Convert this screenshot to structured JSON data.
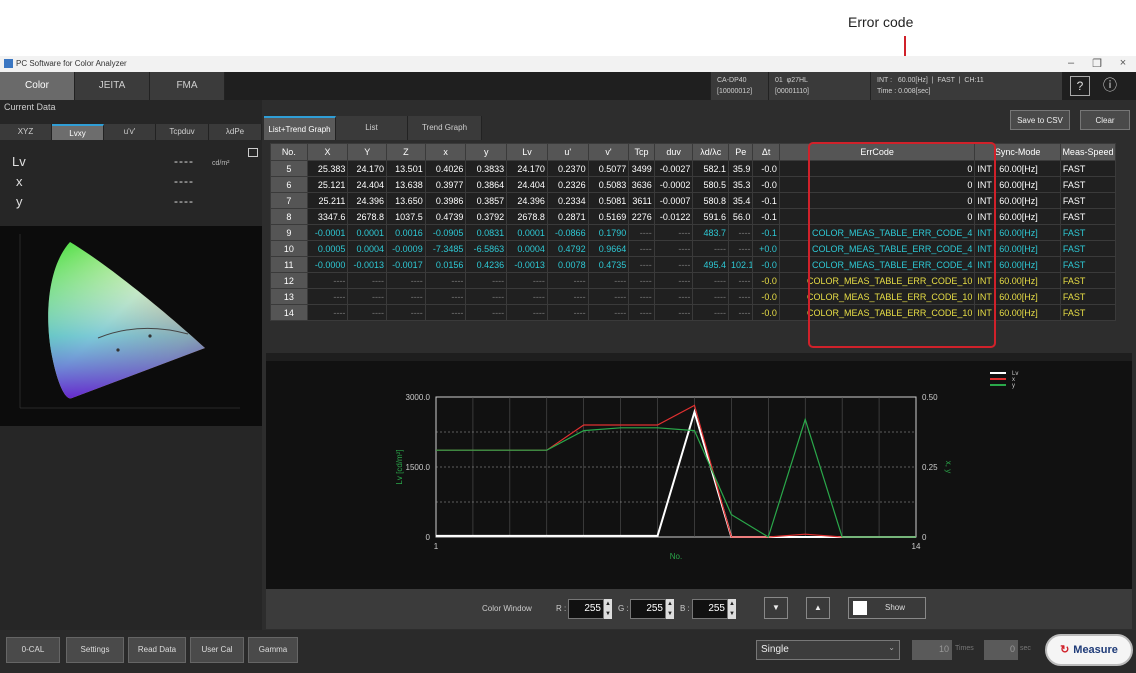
{
  "annotation": {
    "label": "Error code"
  },
  "titlebar": {
    "title": "PC Software for Color Analyzer",
    "min": "–",
    "max": "❐",
    "close": "×"
  },
  "top_tabs": [
    "Color",
    "JEITA",
    "FMA"
  ],
  "status": {
    "device": "CA-DP40\n[10000012]",
    "probe": "01  φ27HL\n[00001110]",
    "sync": "INT :   60.00[Hz]  |  FAST  |  CH:11\nTime : 0.008[sec]",
    "help": "?",
    "info": "ⓘ"
  },
  "left": {
    "current_data": "Current Data",
    "tabs": [
      "XYZ",
      "Lvxy",
      "u'v'",
      "Tcpduv",
      "λdPe"
    ],
    "rows": [
      {
        "label": "Lv",
        "value": "----",
        "unit": "cd/m²"
      },
      {
        "label": "x",
        "value": "----"
      },
      {
        "label": "y",
        "value": "----"
      }
    ]
  },
  "graph_tabs": [
    "List+Trend Graph",
    "List",
    "Trend Graph"
  ],
  "buttons": {
    "save_csv": "Save to CSV",
    "clear": "Clear"
  },
  "table": {
    "headers": [
      "No.",
      "X",
      "Y",
      "Z",
      "x",
      "y",
      "Lv",
      "u'",
      "v'",
      "Tcp",
      "duv",
      "λd/λc",
      "Pe",
      "Δt",
      "ErrCode",
      "Sync-Mode",
      "Meas-Speed"
    ],
    "rows": [
      {
        "style": "",
        "cells": [
          "5",
          "25.383",
          "24.170",
          "13.501",
          "0.4026",
          "0.3833",
          "24.170",
          "0.2370",
          "0.5077",
          "3499",
          "-0.0027",
          "582.1",
          "35.9",
          "-0.0",
          "0",
          "INT : 60.00[Hz]",
          "FAST"
        ]
      },
      {
        "style": "",
        "cells": [
          "6",
          "25.121",
          "24.404",
          "13.638",
          "0.3977",
          "0.3864",
          "24.404",
          "0.2326",
          "0.5083",
          "3636",
          "-0.0002",
          "580.5",
          "35.3",
          "-0.0",
          "0",
          "INT : 60.00[Hz]",
          "FAST"
        ]
      },
      {
        "style": "",
        "cells": [
          "7",
          "25.211",
          "24.396",
          "13.650",
          "0.3986",
          "0.3857",
          "24.396",
          "0.2334",
          "0.5081",
          "3611",
          "-0.0007",
          "580.8",
          "35.4",
          "-0.1",
          "0",
          "INT : 60.00[Hz]",
          "FAST"
        ]
      },
      {
        "style": "",
        "cells": [
          "8",
          "3347.6",
          "2678.8",
          "1037.5",
          "0.4739",
          "0.3792",
          "2678.8",
          "0.2871",
          "0.5169",
          "2276",
          "-0.0122",
          "591.6",
          "56.0",
          "-0.1",
          "0",
          "INT : 60.00[Hz]",
          "FAST"
        ]
      },
      {
        "style": "cyan",
        "cells": [
          "9",
          "-0.0001",
          "0.0001",
          "0.0016",
          "-0.0905",
          "0.0831",
          "0.0001",
          "-0.0866",
          "0.1790",
          "----",
          "----",
          "483.7",
          "----",
          "-0.1",
          "COLOR_MEAS_TABLE_ERR_CODE_4",
          "INT : 60.00[Hz]",
          "FAST"
        ]
      },
      {
        "style": "cyan",
        "cells": [
          "10",
          "0.0005",
          "0.0004",
          "-0.0009",
          "-7.3485",
          "-6.5863",
          "0.0004",
          "0.4792",
          "0.9664",
          "----",
          "----",
          "----",
          "----",
          "+0.0",
          "COLOR_MEAS_TABLE_ERR_CODE_4",
          "INT : 60.00[Hz]",
          "FAST"
        ]
      },
      {
        "style": "cyan",
        "cells": [
          "11",
          "-0.0000",
          "-0.0013",
          "-0.0017",
          "0.0156",
          "0.4236",
          "-0.0013",
          "0.0078",
          "0.4735",
          "----",
          "----",
          "495.4",
          "102.1",
          "-0.0",
          "COLOR_MEAS_TABLE_ERR_CODE_4",
          "INT : 60.00[Hz]",
          "FAST"
        ]
      },
      {
        "style": "yellow",
        "cells": [
          "12",
          "----",
          "----",
          "----",
          "----",
          "----",
          "----",
          "----",
          "----",
          "----",
          "----",
          "----",
          "----",
          "-0.0",
          "COLOR_MEAS_TABLE_ERR_CODE_10",
          "INT : 60.00[Hz]",
          "FAST"
        ]
      },
      {
        "style": "yellow",
        "cells": [
          "13",
          "----",
          "----",
          "----",
          "----",
          "----",
          "----",
          "----",
          "----",
          "----",
          "----",
          "----",
          "----",
          "-0.0",
          "COLOR_MEAS_TABLE_ERR_CODE_10",
          "INT : 60.00[Hz]",
          "FAST"
        ]
      },
      {
        "style": "yellow",
        "cells": [
          "14",
          "----",
          "----",
          "----",
          "----",
          "----",
          "----",
          "----",
          "----",
          "----",
          "----",
          "----",
          "----",
          "-0.0",
          "COLOR_MEAS_TABLE_ERR_CODE_10",
          "INT : 60.00[Hz]",
          "FAST"
        ]
      }
    ]
  },
  "chart_data": {
    "type": "line",
    "xlabel": "No.",
    "ylabel": "Lv [cd/m²]",
    "y2label": "x, y",
    "xlim": [
      1,
      14
    ],
    "ylim": [
      0,
      3000
    ],
    "y2lim": [
      0,
      0.5
    ],
    "yticks": [
      "3000.0",
      "1500.0",
      "0"
    ],
    "y2ticks": [
      "0.50",
      "0.25",
      "0"
    ],
    "xticks": [
      "1",
      "14"
    ],
    "legend": [
      "Lv",
      "x",
      "y"
    ],
    "legend_position": "top-right",
    "x": [
      1,
      2,
      3,
      4,
      5,
      6,
      7,
      8,
      9,
      10,
      11,
      12,
      13,
      14
    ],
    "series": [
      {
        "name": "Lv",
        "color": "#ffffff",
        "axis": "left",
        "values": [
          24.2,
          24.2,
          24.2,
          24.2,
          24.2,
          24.4,
          24.4,
          2678.8,
          0,
          0,
          0,
          0,
          0,
          0
        ]
      },
      {
        "name": "x",
        "color": "#e03030",
        "axis": "right",
        "values": [
          0.31,
          0.31,
          0.31,
          0.31,
          0.4,
          0.4,
          0.4,
          0.47,
          0.0,
          0.0,
          0.01,
          0.0,
          0.0,
          0.0
        ]
      },
      {
        "name": "y",
        "color": "#2aa84a",
        "axis": "right",
        "values": [
          0.31,
          0.31,
          0.31,
          0.31,
          0.38,
          0.39,
          0.39,
          0.38,
          0.08,
          0.0,
          0.42,
          0.0,
          0.0,
          0.0
        ]
      }
    ]
  },
  "color_window": {
    "label": "Color Window",
    "r_label": "R :",
    "g_label": "G :",
    "b_label": "B :",
    "r": "255",
    "g": "255",
    "b": "255",
    "down": "▼",
    "up": "▲",
    "show": "Show"
  },
  "bottom": {
    "buttons": [
      "0-CAL",
      "Settings",
      "Read Data",
      "User Cal",
      "Gamma"
    ],
    "mode": "Single",
    "times_value": "10",
    "times_unit": "Times",
    "sec_value": "0",
    "sec_unit": "sec",
    "measure": "Measure"
  },
  "colors": {
    "accent": "#2f9ed6",
    "annotation": "#d0212a",
    "cyan_text": "#2ec8d4",
    "yellow_text": "#e8de46"
  }
}
